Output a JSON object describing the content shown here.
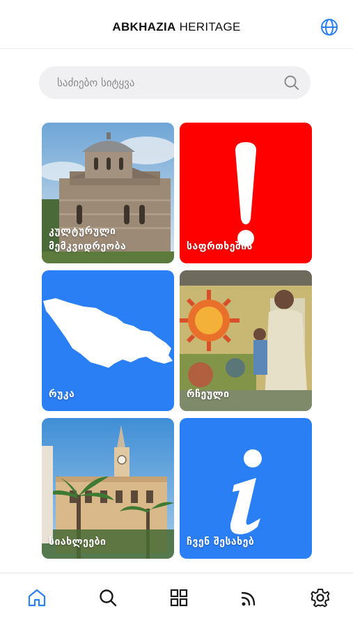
{
  "header": {
    "title_bold": "ABKHAZIA",
    "title_light": " HERITAGE",
    "language_icon": "globe-icon"
  },
  "search": {
    "placeholder": "საძიებო სიტყვა",
    "icon": "search-icon"
  },
  "tiles": [
    {
      "line1": "კულტურული",
      "line2": "მემკვიდრეობა",
      "image": "cathedral-photo"
    },
    {
      "line1": "საფრთხეშია",
      "line2": "",
      "icon": "exclamation-icon",
      "color": "#ff0000"
    },
    {
      "line1": "რუკა",
      "line2": "",
      "icon": "georgia-map-silhouette",
      "color": "#2b7ff5"
    },
    {
      "line1": "რჩეული",
      "line2": "",
      "image": "mosaic-photo"
    },
    {
      "line1": "სიახლეები",
      "line2": "",
      "image": "clock-tower-photo"
    },
    {
      "line1": "ჩვენ შესახებ",
      "line2": "",
      "icon": "info-icon",
      "color": "#2b7ff5"
    }
  ],
  "nav": {
    "items": [
      "home-icon",
      "search-icon",
      "grid-icon",
      "rss-icon",
      "settings-icon"
    ],
    "active": "home-icon"
  },
  "colors": {
    "accent": "#2b7ff5",
    "danger": "#ff0000"
  }
}
